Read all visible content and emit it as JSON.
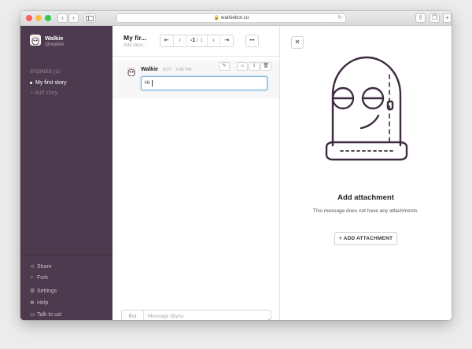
{
  "browser": {
    "url": "walkiebot.co"
  },
  "sidebar": {
    "bot_name": "Walkie",
    "bot_handle": "@walkie",
    "stories_header": "STORIES (1)",
    "stories": [
      {
        "label": "My first story",
        "active": true
      }
    ],
    "add_story": "+ Add story",
    "footer_items": [
      {
        "label": "Share",
        "icon": "share-icon"
      },
      {
        "label": "Fork",
        "icon": "fork-icon"
      },
      {
        "label": "Settings",
        "icon": "gear-icon"
      },
      {
        "label": "Help",
        "icon": "help-icon"
      },
      {
        "label": "Talk to us!",
        "icon": "chat-icon"
      }
    ]
  },
  "story": {
    "title": "My fir...",
    "description_placeholder": "Add desc...",
    "pager": {
      "current": "-1",
      "total": "/ 1"
    },
    "more_label": "•••"
  },
  "message": {
    "sender": "Walkie",
    "badge": "BOT",
    "time": "2:46 PM",
    "text": "Hi"
  },
  "composer": {
    "sender_label": "Bot",
    "placeholder": "Message @you"
  },
  "attachment_panel": {
    "title": "Add attachment",
    "subtitle": "This message does not have any attachments.",
    "button_label": "+ ADD ATTACHMENT"
  },
  "colors": {
    "sidebar_bg": "#4d3a4e",
    "accent_blue": "#6ab0de",
    "robot_stroke": "#3d2b3f"
  }
}
